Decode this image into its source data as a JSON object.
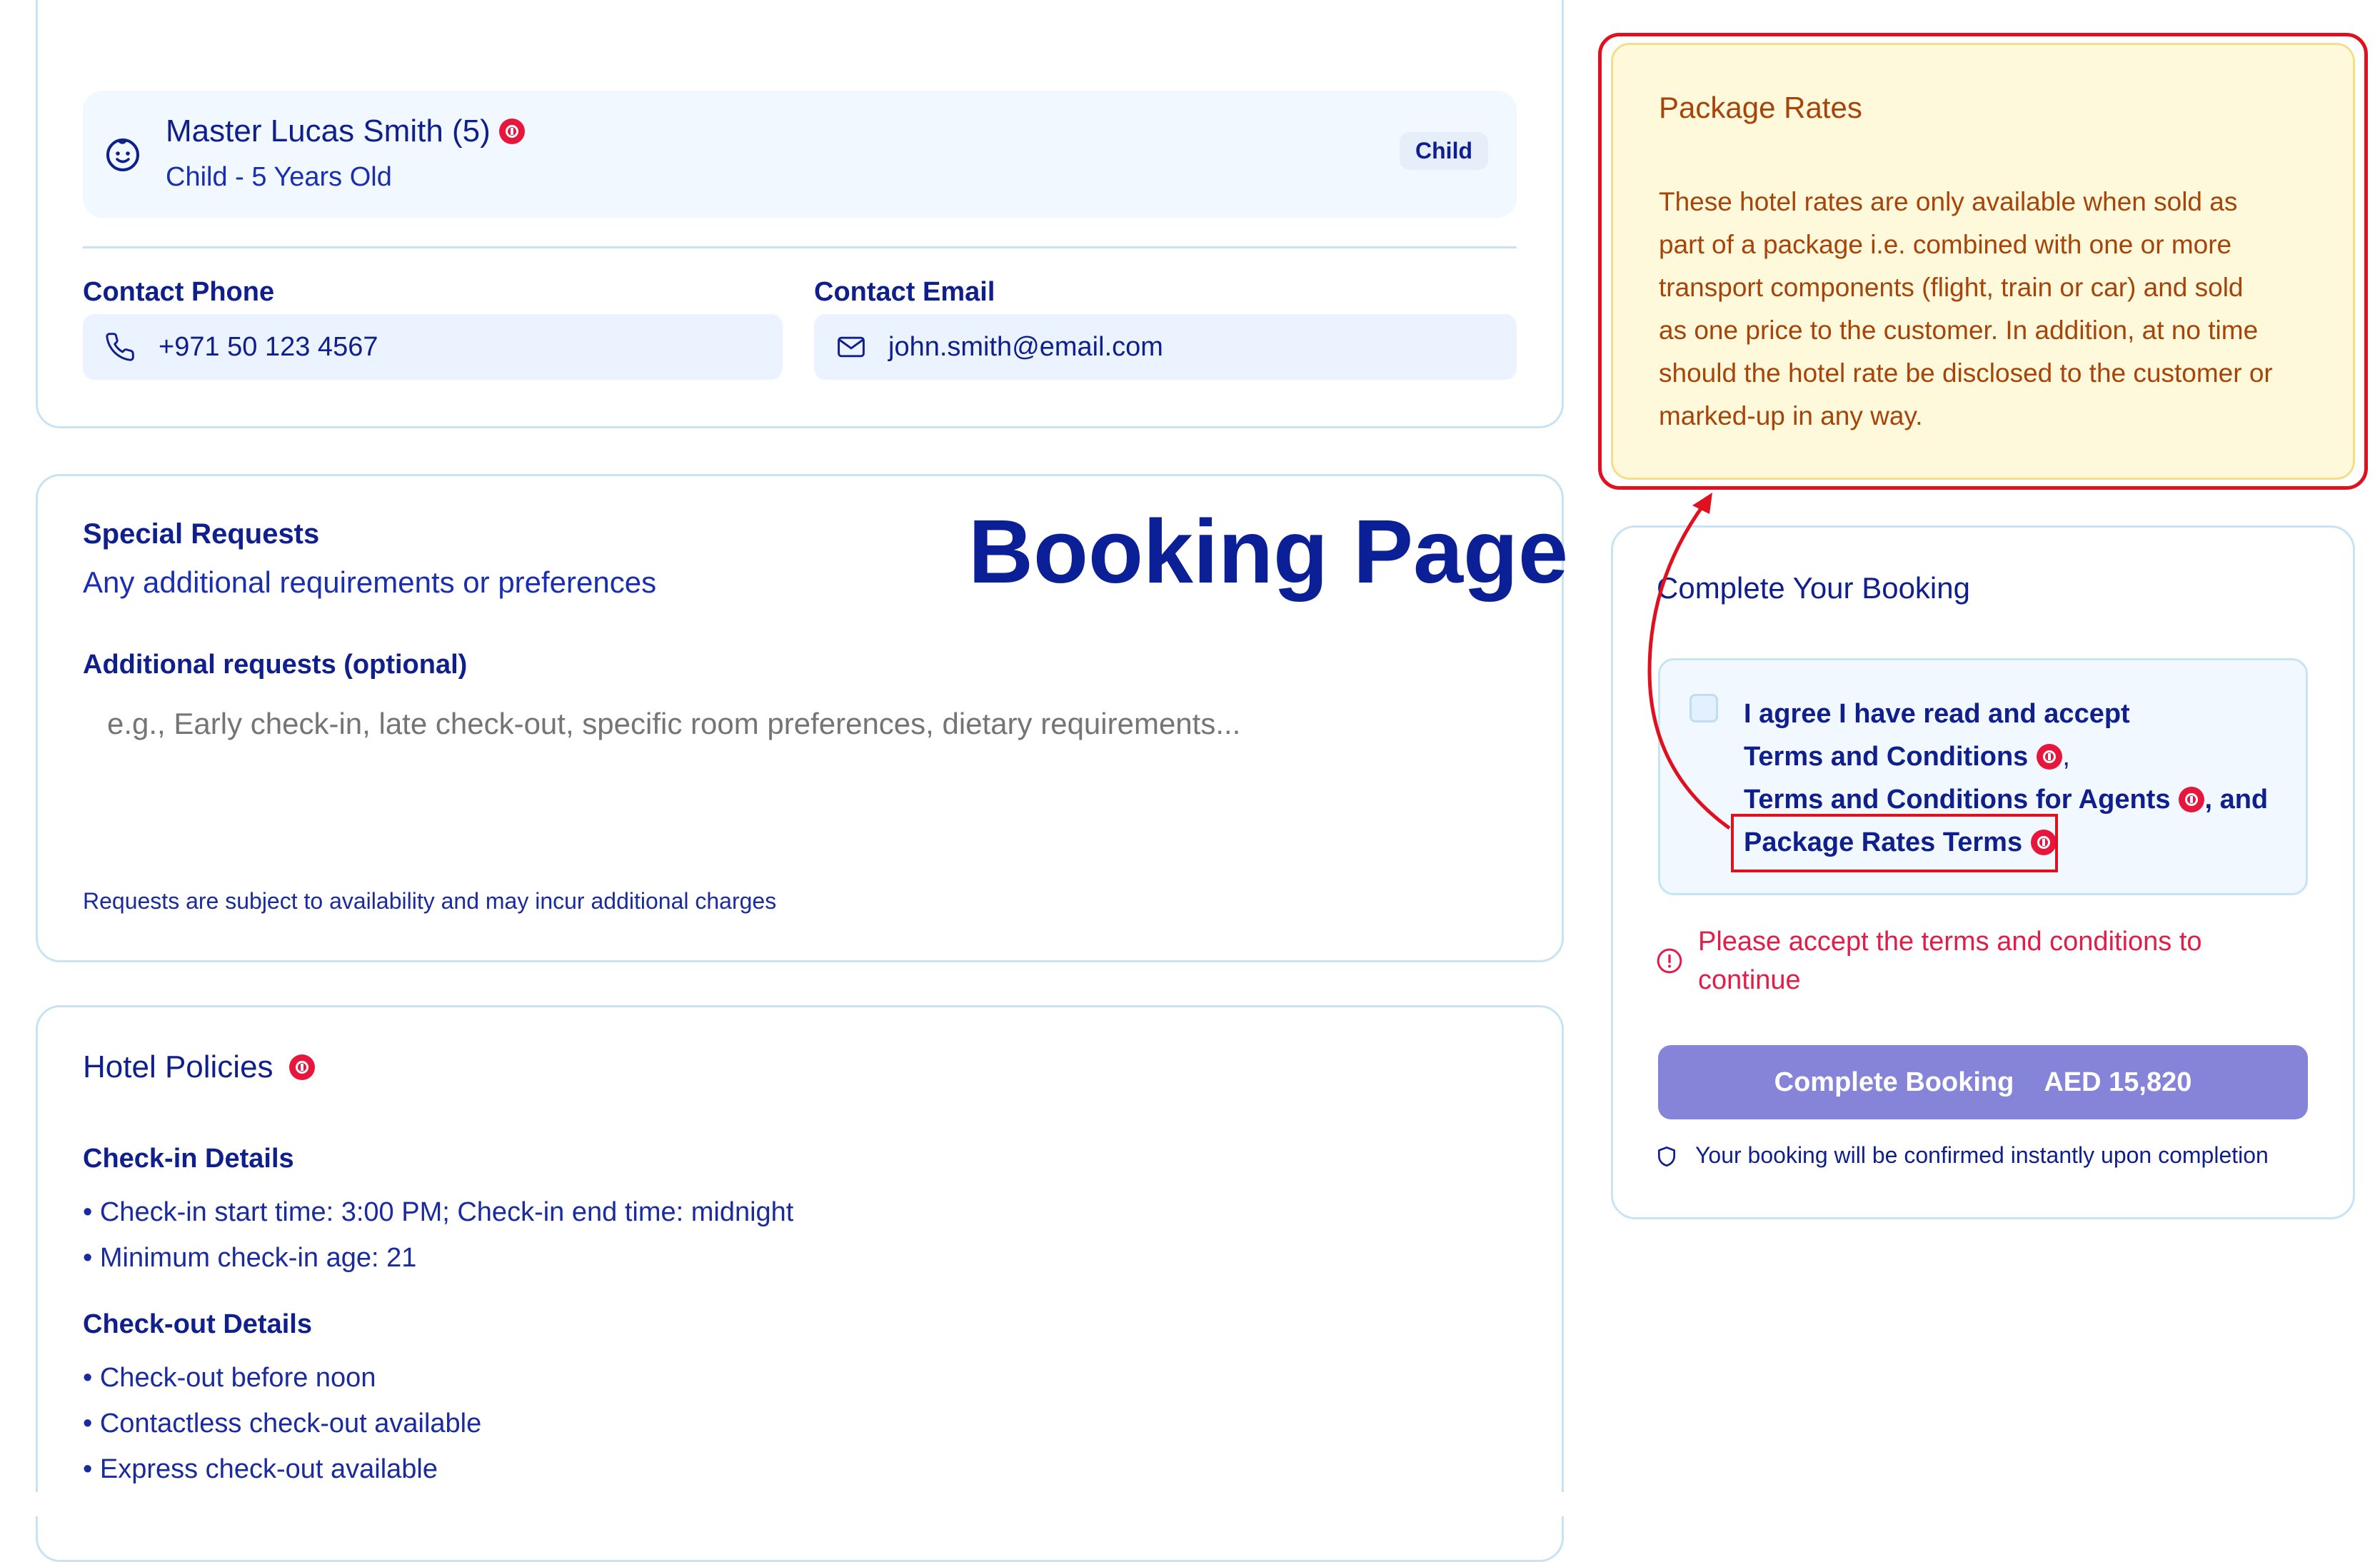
{
  "page_heading": "Booking Page",
  "guest": {
    "name": "Master Lucas Smith (5)",
    "subtitle": "Child - 5 Years Old",
    "badge": "Child"
  },
  "contact": {
    "phone_label": "Contact Phone",
    "phone_value": "+971 50 123 4567",
    "email_label": "Contact Email",
    "email_value": "john.smith@email.com"
  },
  "special_requests": {
    "title": "Special Requests",
    "subtitle": "Any additional requirements or preferences",
    "field_label": "Additional requests (optional)",
    "placeholder": "e.g., Early check-in, late check-out, specific room preferences, dietary requirements...",
    "note": "Requests are subject to availability and may incur additional charges"
  },
  "hotel_policies": {
    "title": "Hotel Policies",
    "checkin_title": "Check-in Details",
    "checkin_items": [
      "• Check-in start time: 3:00 PM; Check-in end time: midnight",
      "• Minimum check-in age: 21"
    ],
    "checkout_title": "Check-out Details",
    "checkout_items": [
      "• Check-out before noon",
      "• Contactless check-out available",
      "• Express check-out available"
    ]
  },
  "package_rates": {
    "title": "Package Rates",
    "lines": [
      "These hotel rates are only available when sold as",
      "part of a package i.e. combined with one or more",
      "transport components (flight, train or car) and sold",
      "as one price to the customer. In addition, at no time",
      "should the hotel rate be disclosed to the customer or",
      "marked-up in any way."
    ]
  },
  "complete_booking": {
    "title": "Complete Your Booking",
    "agree_text": "I agree I have read and accept",
    "terms_link": "Terms and Conditions",
    "comma": ",",
    "agents_link": "Terms and Conditions for Agents",
    "and_text": ", and",
    "package_link": "Package Rates Terms",
    "error_line1": "Please accept the terms and conditions to",
    "error_line2": "continue",
    "button_label": "Complete Booking",
    "button_price": "AED 15,820",
    "confirm_note": "Your booking will be confirmed instantly upon completion"
  },
  "colors": {
    "navy": "#0f1f8c",
    "info_red": "#e8163c",
    "annotation_red": "#e0101f",
    "package_bg": "#fff9dc",
    "package_text": "#a6440a",
    "button_bg": "#8584d8",
    "error_text": "#e11d48"
  }
}
